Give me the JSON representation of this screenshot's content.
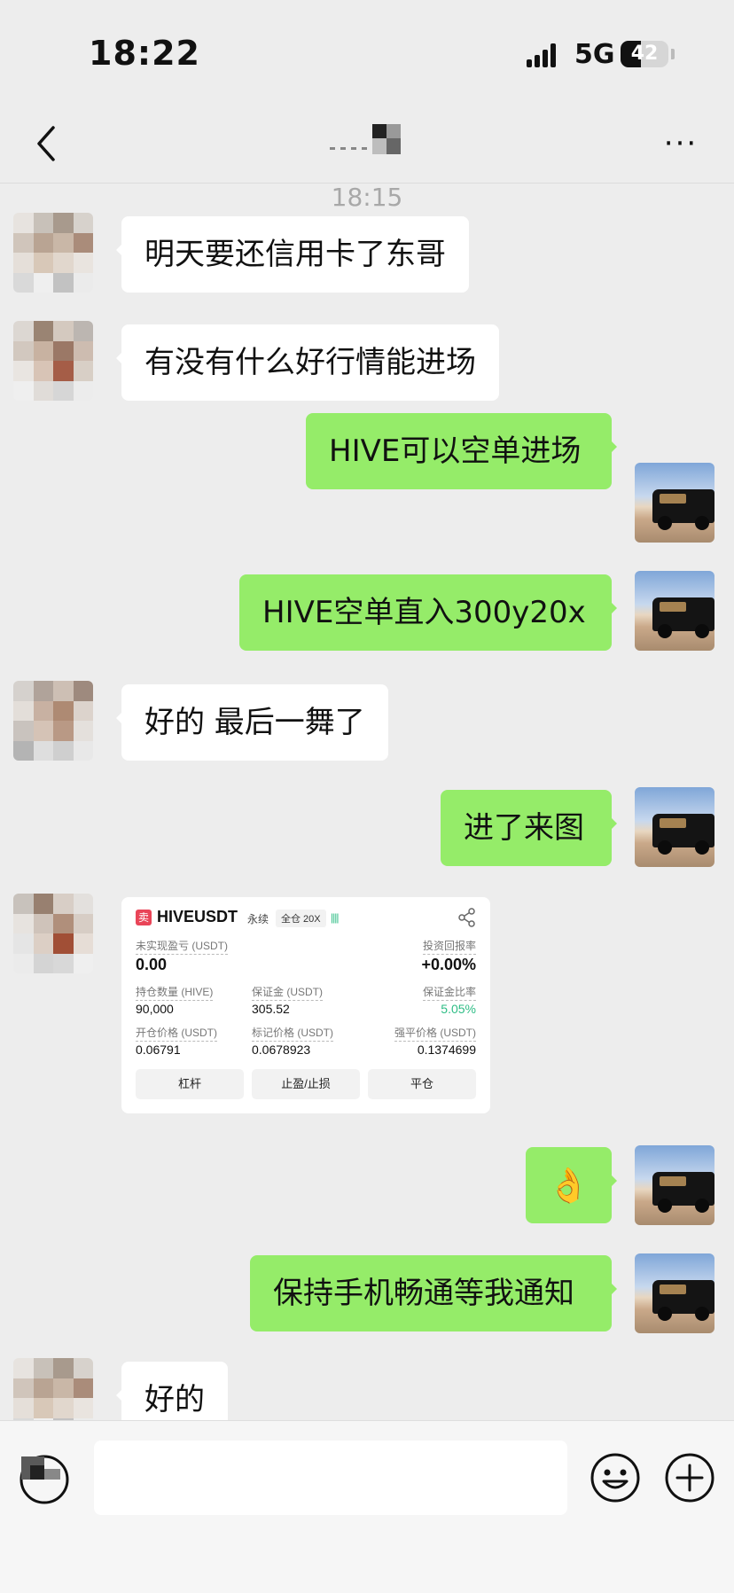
{
  "status": {
    "time": "18:22",
    "network": "5G",
    "battery": "42",
    "battery_level": 0.42
  },
  "header": {
    "back_icon": "chevron-left-icon",
    "more_label": "···"
  },
  "chat": {
    "timestamp": "18:15",
    "messages": [
      {
        "side": "left",
        "text": "明天要还信用卡了东哥"
      },
      {
        "side": "left",
        "text": "有没有什么好行情能进场"
      },
      {
        "side": "right",
        "text": "HIVE可以空单进场"
      },
      {
        "side": "right",
        "text": "HIVE空单直入300y20x"
      },
      {
        "side": "left",
        "text": "好的 最后一舞了"
      },
      {
        "side": "right",
        "text": "进了来图"
      },
      {
        "side": "right",
        "text": "👌"
      },
      {
        "side": "right",
        "text": "保持手机畅通等我通知"
      },
      {
        "side": "left",
        "text": "好的"
      }
    ],
    "trade_card": {
      "sell_badge": "卖",
      "symbol": "HIVEUSDT",
      "contract": "永续",
      "mode": "全仓 20X",
      "bars": "||||",
      "unrealized_pnl_label": "未实现盈亏 (USDT)",
      "unrealized_pnl_value": "0.00",
      "roi_label": "投资回报率",
      "roi_value": "+0.00%",
      "position_qty_label": "持仓数量 (HIVE)",
      "position_qty_value": "90,000",
      "margin_label": "保证金 (USDT)",
      "margin_value": "305.52",
      "margin_ratio_label": "保证金比率",
      "margin_ratio_value": "5.05%",
      "entry_price_label": "开仓价格 (USDT)",
      "entry_price_value": "0.06791",
      "mark_price_label": "标记价格 (USDT)",
      "mark_price_value": "0.0678923",
      "liq_price_label": "强平价格 (USDT)",
      "liq_price_value": "0.1374699",
      "btn_leverage": "杠杆",
      "btn_tpsl": "止盈/止损",
      "btn_close": "平仓"
    }
  },
  "input": {
    "voice_icon": "voice-icon",
    "emoji_icon": "emoji-icon",
    "plus_icon": "plus-icon"
  },
  "colors": {
    "bg": "#ededed",
    "sent_bubble": "#95ec69",
    "received_bubble": "#ffffff",
    "profit_green": "#2ebd85",
    "sell_red": "#e94558"
  }
}
